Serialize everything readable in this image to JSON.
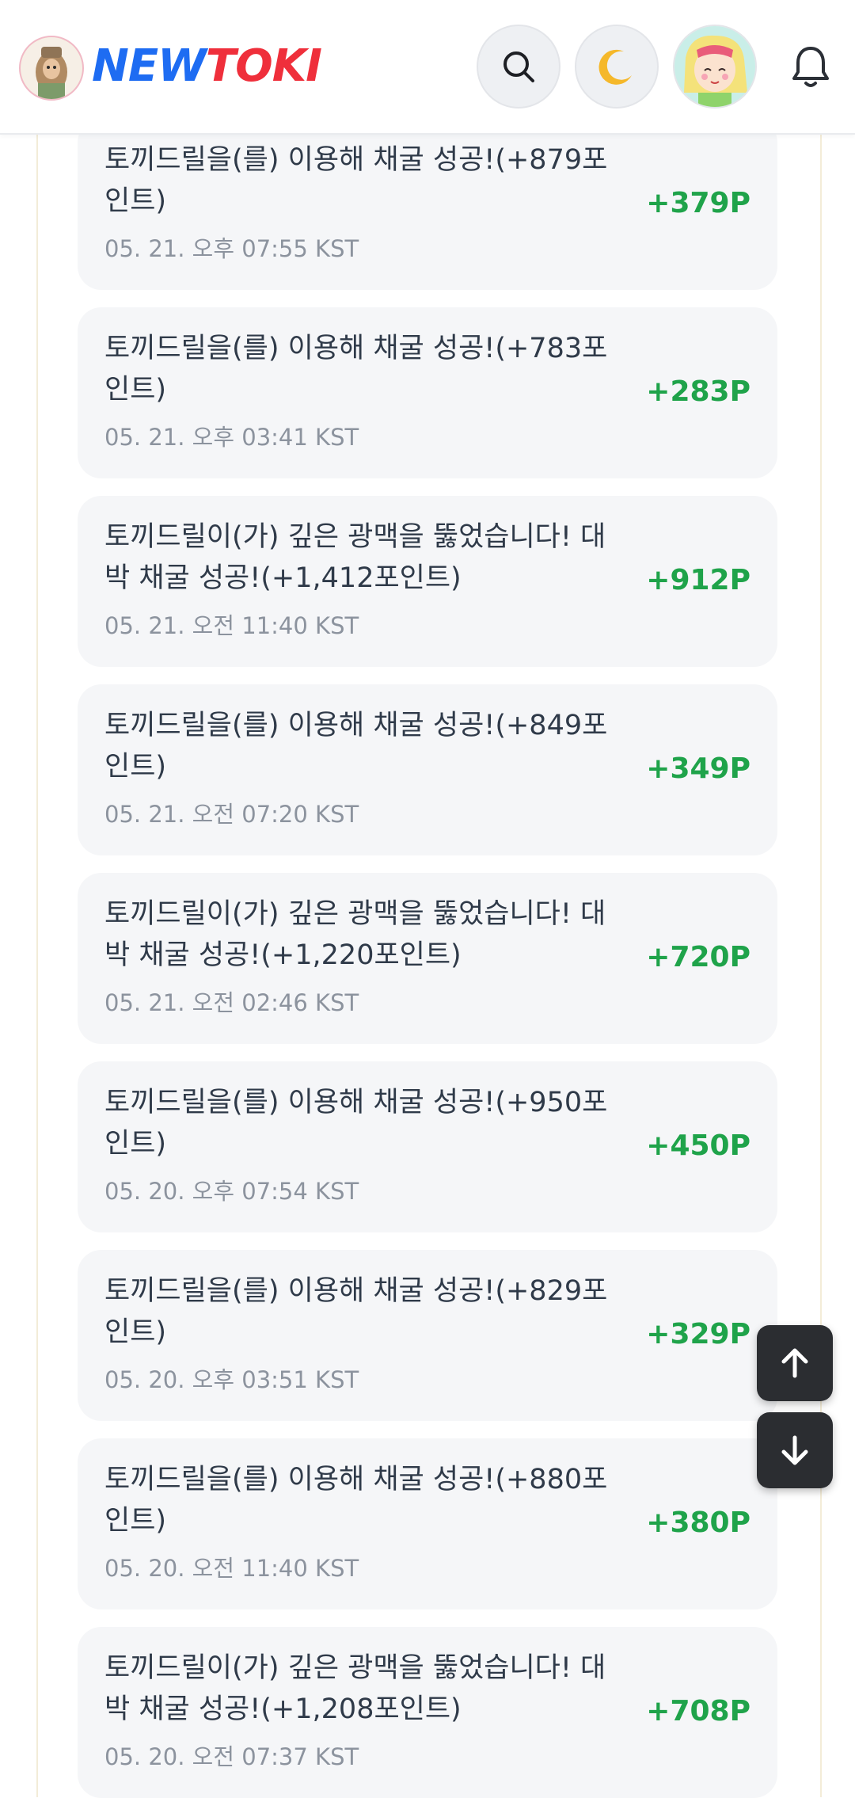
{
  "header": {
    "logo_part1": "NEW",
    "logo_part2": "TOKI",
    "icons": [
      "search-icon",
      "moon-icon",
      "user-avatar",
      "bell-icon"
    ]
  },
  "colors": {
    "logo_blue": "#1e6cf2",
    "logo_red": "#ef2f3b",
    "points_green": "#1fa34a",
    "card_bg": "#f5f6f8"
  },
  "history": [
    {
      "desc": "토끼드릴을(를) 이용해 채굴 성공!(+879포인트)",
      "date": "05. 21. 오후 07:55 KST",
      "points": "+379P"
    },
    {
      "desc": "토끼드릴을(를) 이용해 채굴 성공!(+783포인트)",
      "date": "05. 21. 오후 03:41 KST",
      "points": "+283P"
    },
    {
      "desc": "토끼드릴이(가) 깊은 광맥을 뚫었습니다! 대박 채굴 성공!(+1,412포인트)",
      "date": "05. 21. 오전 11:40 KST",
      "points": "+912P"
    },
    {
      "desc": "토끼드릴을(를) 이용해 채굴 성공!(+849포인트)",
      "date": "05. 21. 오전 07:20 KST",
      "points": "+349P"
    },
    {
      "desc": "토끼드릴이(가) 깊은 광맥을 뚫었습니다! 대박 채굴 성공!(+1,220포인트)",
      "date": "05. 21. 오전 02:46 KST",
      "points": "+720P"
    },
    {
      "desc": "토끼드릴을(를) 이용해 채굴 성공!(+950포인트)",
      "date": "05. 20. 오후 07:54 KST",
      "points": "+450P"
    },
    {
      "desc": "토끼드릴을(를) 이용해 채굴 성공!(+829포인트)",
      "date": "05. 20. 오후 03:51 KST",
      "points": "+329P"
    },
    {
      "desc": "토끼드릴을(를) 이용해 채굴 성공!(+880포인트)",
      "date": "05. 20. 오전 11:40 KST",
      "points": "+380P"
    },
    {
      "desc": "토끼드릴이(가) 깊은 광맥을 뚫었습니다! 대박 채굴 성공!(+1,208포인트)",
      "date": "05. 20. 오전 07:37 KST",
      "points": "+708P"
    }
  ],
  "floating_buttons": [
    "arrow-up-icon",
    "arrow-down-icon"
  ]
}
